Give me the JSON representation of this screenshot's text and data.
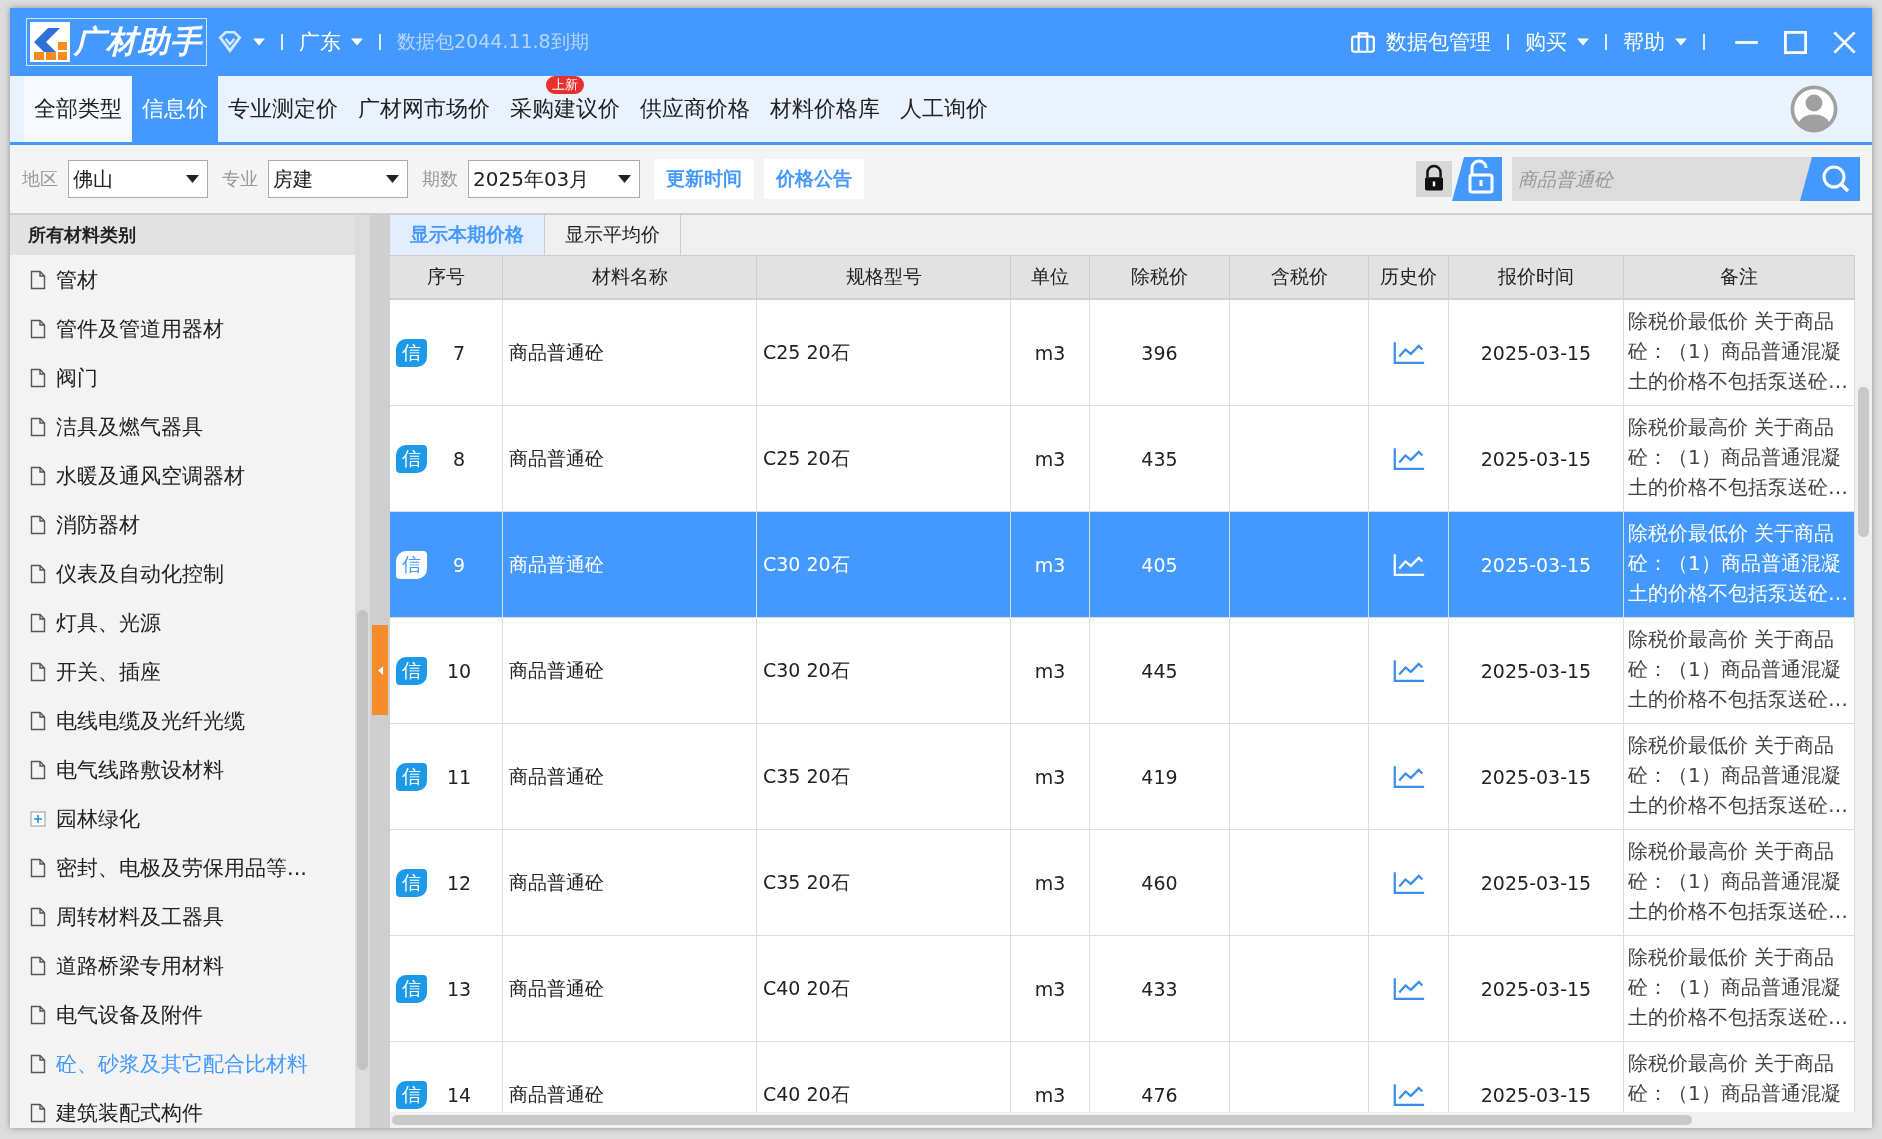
{
  "title_bar": {
    "logo_text": "广材助手",
    "region": "广东",
    "package_notice": "数据包2044.11.8到期",
    "package_manager": "数据包管理",
    "menus": [
      "购买",
      "帮助"
    ]
  },
  "tabs": [
    {
      "label": "全部类型",
      "selected": false
    },
    {
      "label": "信息价",
      "selected": true
    },
    {
      "label": "专业测定价",
      "selected": false
    },
    {
      "label": "广材网市场价",
      "selected": false
    },
    {
      "label": "采购建议价",
      "selected": false,
      "badge": "上新"
    },
    {
      "label": "供应商价格",
      "selected": false
    },
    {
      "label": "材料价格库",
      "selected": false
    },
    {
      "label": "人工询价",
      "selected": false
    }
  ],
  "filters": [
    {
      "label": "地区",
      "value": "佛山"
    },
    {
      "label": "专业",
      "value": "房建"
    },
    {
      "label": "期数",
      "value": "2025年03月"
    }
  ],
  "toolbar_buttons": [
    "更新时间",
    "价格公告"
  ],
  "search": {
    "placeholder": "商品普通砼"
  },
  "sidebar": {
    "header": "所有材料类别",
    "items": [
      {
        "label": "管材",
        "kind": "leaf",
        "selected": false
      },
      {
        "label": "管件及管道用器材",
        "kind": "leaf",
        "selected": false
      },
      {
        "label": "阀门",
        "kind": "leaf",
        "selected": false
      },
      {
        "label": "洁具及燃气器具",
        "kind": "leaf",
        "selected": false
      },
      {
        "label": "水暖及通风空调器材",
        "kind": "leaf",
        "selected": false
      },
      {
        "label": "消防器材",
        "kind": "leaf",
        "selected": false
      },
      {
        "label": "仪表及自动化控制",
        "kind": "leaf",
        "selected": false
      },
      {
        "label": "灯具、光源",
        "kind": "leaf",
        "selected": false
      },
      {
        "label": "开关、插座",
        "kind": "leaf",
        "selected": false
      },
      {
        "label": "电线电缆及光纤光缆",
        "kind": "leaf",
        "selected": false
      },
      {
        "label": "电气线路敷设材料",
        "kind": "leaf",
        "selected": false
      },
      {
        "label": "园林绿化",
        "kind": "group",
        "selected": false
      },
      {
        "label": "密封、电极及劳保用品等...",
        "kind": "leaf",
        "selected": false
      },
      {
        "label": "周转材料及工器具",
        "kind": "leaf",
        "selected": false
      },
      {
        "label": "道路桥梁专用材料",
        "kind": "leaf",
        "selected": false
      },
      {
        "label": "电气设备及附件",
        "kind": "leaf",
        "selected": false
      },
      {
        "label": "砼、砂浆及其它配合比材料",
        "kind": "leaf",
        "selected": true
      },
      {
        "label": "建筑装配式构件",
        "kind": "leaf",
        "selected": false
      }
    ]
  },
  "view_tabs": [
    {
      "label": "显示本期价格",
      "selected": true
    },
    {
      "label": "显示平均价",
      "selected": false
    }
  ],
  "table": {
    "columns": [
      "序号",
      "材料名称",
      "规格型号",
      "单位",
      "除税价",
      "含税价",
      "历史价",
      "报价时间",
      "备注"
    ],
    "rows": [
      {
        "tag": "信",
        "no": "7",
        "name": "商品普通砼",
        "spec": "C25 20石",
        "unit": "m3",
        "price_ex_tax": "396",
        "date": "2025-03-15",
        "note": "除税价最低价 关于商品砼：（1）商品普通混凝土的价格不包括泵送砼…",
        "selected": false
      },
      {
        "tag": "信",
        "no": "8",
        "name": "商品普通砼",
        "spec": "C25 20石",
        "unit": "m3",
        "price_ex_tax": "435",
        "date": "2025-03-15",
        "note": "除税价最高价 关于商品砼：（1）商品普通混凝土的价格不包括泵送砼…",
        "selected": false
      },
      {
        "tag": "信",
        "no": "9",
        "name": "商品普通砼",
        "spec": "C30 20石",
        "unit": "m3",
        "price_ex_tax": "405",
        "date": "2025-03-15",
        "note": "除税价最低价 关于商品砼：（1）商品普通混凝土的价格不包括泵送砼…",
        "selected": true
      },
      {
        "tag": "信",
        "no": "10",
        "name": "商品普通砼",
        "spec": "C30 20石",
        "unit": "m3",
        "price_ex_tax": "445",
        "date": "2025-03-15",
        "note": "除税价最高价 关于商品砼：（1）商品普通混凝土的价格不包括泵送砼…",
        "selected": false
      },
      {
        "tag": "信",
        "no": "11",
        "name": "商品普通砼",
        "spec": "C35 20石",
        "unit": "m3",
        "price_ex_tax": "419",
        "date": "2025-03-15",
        "note": "除税价最低价 关于商品砼：（1）商品普通混凝土的价格不包括泵送砼…",
        "selected": false
      },
      {
        "tag": "信",
        "no": "12",
        "name": "商品普通砼",
        "spec": "C35 20石",
        "unit": "m3",
        "price_ex_tax": "460",
        "date": "2025-03-15",
        "note": "除税价最高价 关于商品砼：（1）商品普通混凝土的价格不包括泵送砼…",
        "selected": false
      },
      {
        "tag": "信",
        "no": "13",
        "name": "商品普通砼",
        "spec": "C40 20石",
        "unit": "m3",
        "price_ex_tax": "433",
        "date": "2025-03-15",
        "note": "除税价最低价 关于商品砼：（1）商品普通混凝土的价格不包括泵送砼…",
        "selected": false
      },
      {
        "tag": "信",
        "no": "14",
        "name": "商品普通砼",
        "spec": "C40 20石",
        "unit": "m3",
        "price_ex_tax": "476",
        "date": "2025-03-15",
        "note": "除税价最高价 关于商品砼：（1）商品普通混凝",
        "selected": false
      }
    ]
  }
}
